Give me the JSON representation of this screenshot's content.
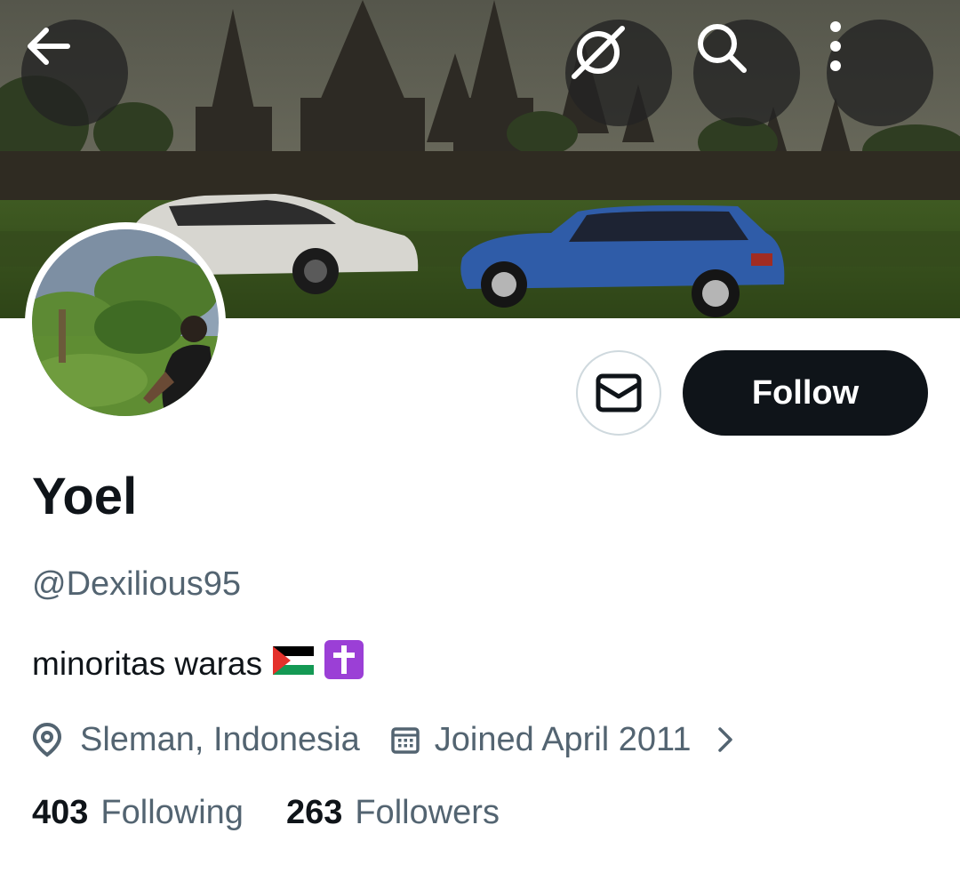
{
  "header": {
    "back_icon": "arrow-left-icon",
    "grok_icon": "grok-slash-circle-icon",
    "search_icon": "search-icon",
    "more_icon": "more-vertical-icon"
  },
  "actions": {
    "message_icon": "envelope-icon",
    "follow_label": "Follow"
  },
  "profile": {
    "name": "Yoel",
    "handle": "@Dexilious95",
    "bio_text": "minoritas waras",
    "bio_emojis": [
      "palestine-flag",
      "latin-cross"
    ],
    "location": "Sleman, Indonesia",
    "joined": "Joined April 2011"
  },
  "stats": {
    "following_count": "403",
    "following_label": "Following",
    "followers_count": "263",
    "followers_label": "Followers"
  },
  "colors": {
    "primary_text": "#0f1419",
    "secondary_text": "#536471",
    "follow_button_bg": "#0f1419",
    "border": "#cfd9de"
  }
}
